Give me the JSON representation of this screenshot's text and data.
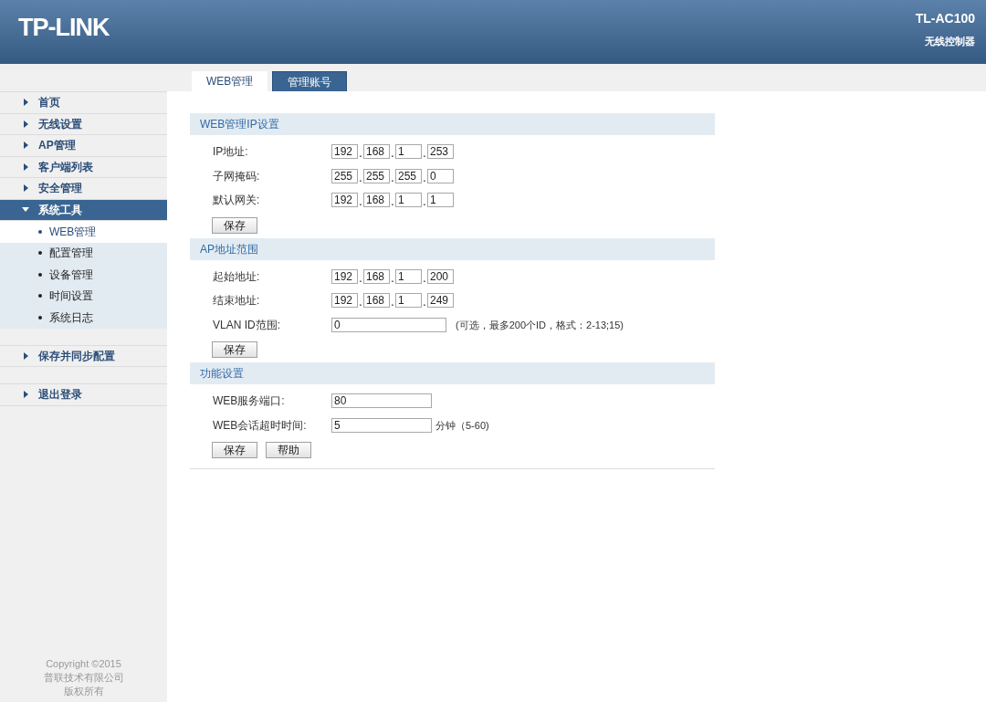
{
  "header": {
    "logo": "TP-LINK",
    "model": "TL-AC100",
    "subtitle": "无线控制器"
  },
  "tabs": [
    {
      "label": "WEB管理",
      "selected": true
    },
    {
      "label": "管理账号",
      "selected": false
    }
  ],
  "sidebar": {
    "groups": [
      {
        "items": [
          {
            "label": "首页",
            "expanded": false
          },
          {
            "label": "无线设置",
            "expanded": false
          },
          {
            "label": "AP管理",
            "expanded": false
          },
          {
            "label": "客户端列表",
            "expanded": false
          },
          {
            "label": "安全管理",
            "expanded": false
          },
          {
            "label": "系统工具",
            "expanded": true,
            "children": [
              {
                "label": "WEB管理",
                "selected": true
              },
              {
                "label": "配置管理",
                "selected": false
              },
              {
                "label": "设备管理",
                "selected": false
              },
              {
                "label": "时间设置",
                "selected": false
              },
              {
                "label": "系统日志",
                "selected": false
              }
            ]
          }
        ]
      },
      {
        "items": [
          {
            "label": "保存并同步配置",
            "expanded": false
          }
        ]
      },
      {
        "items": [
          {
            "label": "退出登录",
            "expanded": false
          }
        ]
      }
    ],
    "copyright": [
      "Copyright ©2015",
      "普联技术有限公司",
      "版权所有"
    ]
  },
  "sections": [
    {
      "title": "WEB管理IP设置",
      "rows": [
        {
          "kind": "ip",
          "label": "IP地址:",
          "separator": ".",
          "octets": [
            "192",
            "168",
            "1",
            "253"
          ]
        },
        {
          "kind": "ip",
          "label": "子网掩码:",
          "separator": ".",
          "octets": [
            "255",
            "255",
            "255",
            "0"
          ]
        },
        {
          "kind": "ip",
          "label": "默认网关:",
          "separator": ".",
          "octets": [
            "192",
            "168",
            "1",
            "1"
          ]
        }
      ],
      "buttons": [
        "保存"
      ]
    },
    {
      "title": "AP地址范围",
      "rows": [
        {
          "kind": "ip",
          "label": "起始地址:",
          "separator": ".",
          "octets": [
            "192",
            "168",
            "1",
            "200"
          ]
        },
        {
          "kind": "ip",
          "label": "结束地址:",
          "separator": ".",
          "octets": [
            "192",
            "168",
            "1",
            "249"
          ]
        },
        {
          "kind": "text",
          "label": "VLAN ID范围:",
          "value": "0",
          "note": "(可选，最多200个ID，格式：2-13;15)"
        }
      ],
      "buttons": [
        "保存"
      ]
    },
    {
      "title": "功能设置",
      "rows": [
        {
          "kind": "text",
          "label": "WEB服务端口:",
          "value": "80"
        },
        {
          "kind": "text",
          "label": "WEB会话超时时间:",
          "value": "5",
          "note": "分钟（5-60)"
        }
      ],
      "buttons": [
        "保存",
        "帮助"
      ]
    }
  ]
}
